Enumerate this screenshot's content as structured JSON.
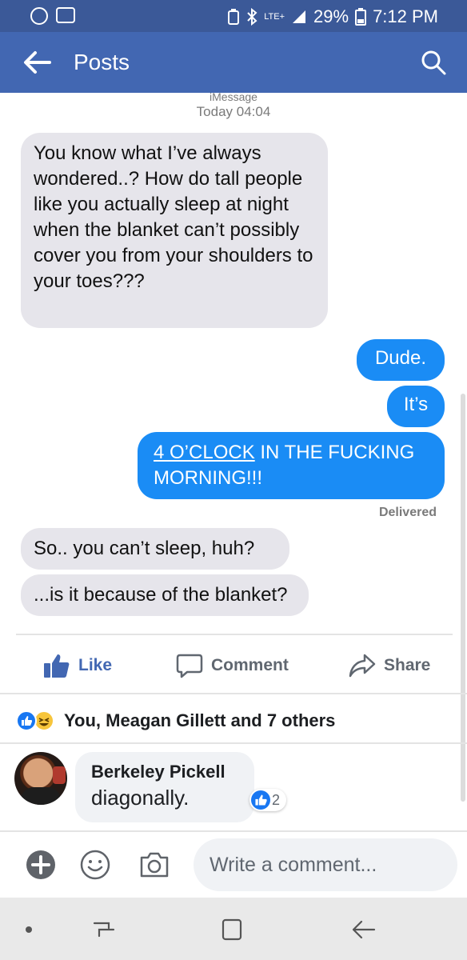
{
  "status_bar": {
    "network": "LTE+",
    "battery": "29%",
    "time": "7:12 PM",
    "icons": [
      "do-not-disturb-icon",
      "app-notification-icon",
      "battery-saver-icon",
      "bluetooth-icon",
      "signal-icon",
      "battery-icon"
    ]
  },
  "app_bar": {
    "title": "Posts",
    "back_icon": "arrow-left-icon",
    "search_icon": "search-icon"
  },
  "post_image": {
    "service": "iMessage",
    "date": "Today 04:04",
    "messages": [
      {
        "side": "received",
        "text": "You know what I’ve always wondered..? How do tall people like you actually sleep at night when the blanket can’t possibly cover you from your shoulders to your toes???"
      },
      {
        "side": "sent",
        "text": "Dude."
      },
      {
        "side": "sent",
        "text": "It’s"
      },
      {
        "side": "sent",
        "text_underlined": "4 O’CLOCK",
        "text_rest": " IN THE FUCKING MORNING!!!"
      },
      {
        "side": "received",
        "text": "So.. you can’t sleep, huh?"
      },
      {
        "side": "received",
        "text": "...is it because of the blanket?"
      }
    ],
    "delivered": "Delivered",
    "colors": {
      "sent": "#1a8cf5",
      "received": "#e6e5eb"
    }
  },
  "actions": {
    "like": "Like",
    "comment": "Comment",
    "share": "Share"
  },
  "reactions": {
    "summary": "You, Meagan Gillett and 7 others",
    "icons": [
      "like-reaction-icon",
      "haha-reaction-icon"
    ]
  },
  "comment": {
    "author": "Berkeley Pickell",
    "text": "diagonally.",
    "reaction_count": "2"
  },
  "composer": {
    "placeholder": "Write a comment..."
  },
  "colors": {
    "facebook_blue": "#4267b2",
    "status_blue": "#3b5998",
    "like_blue": "#1877f2"
  }
}
